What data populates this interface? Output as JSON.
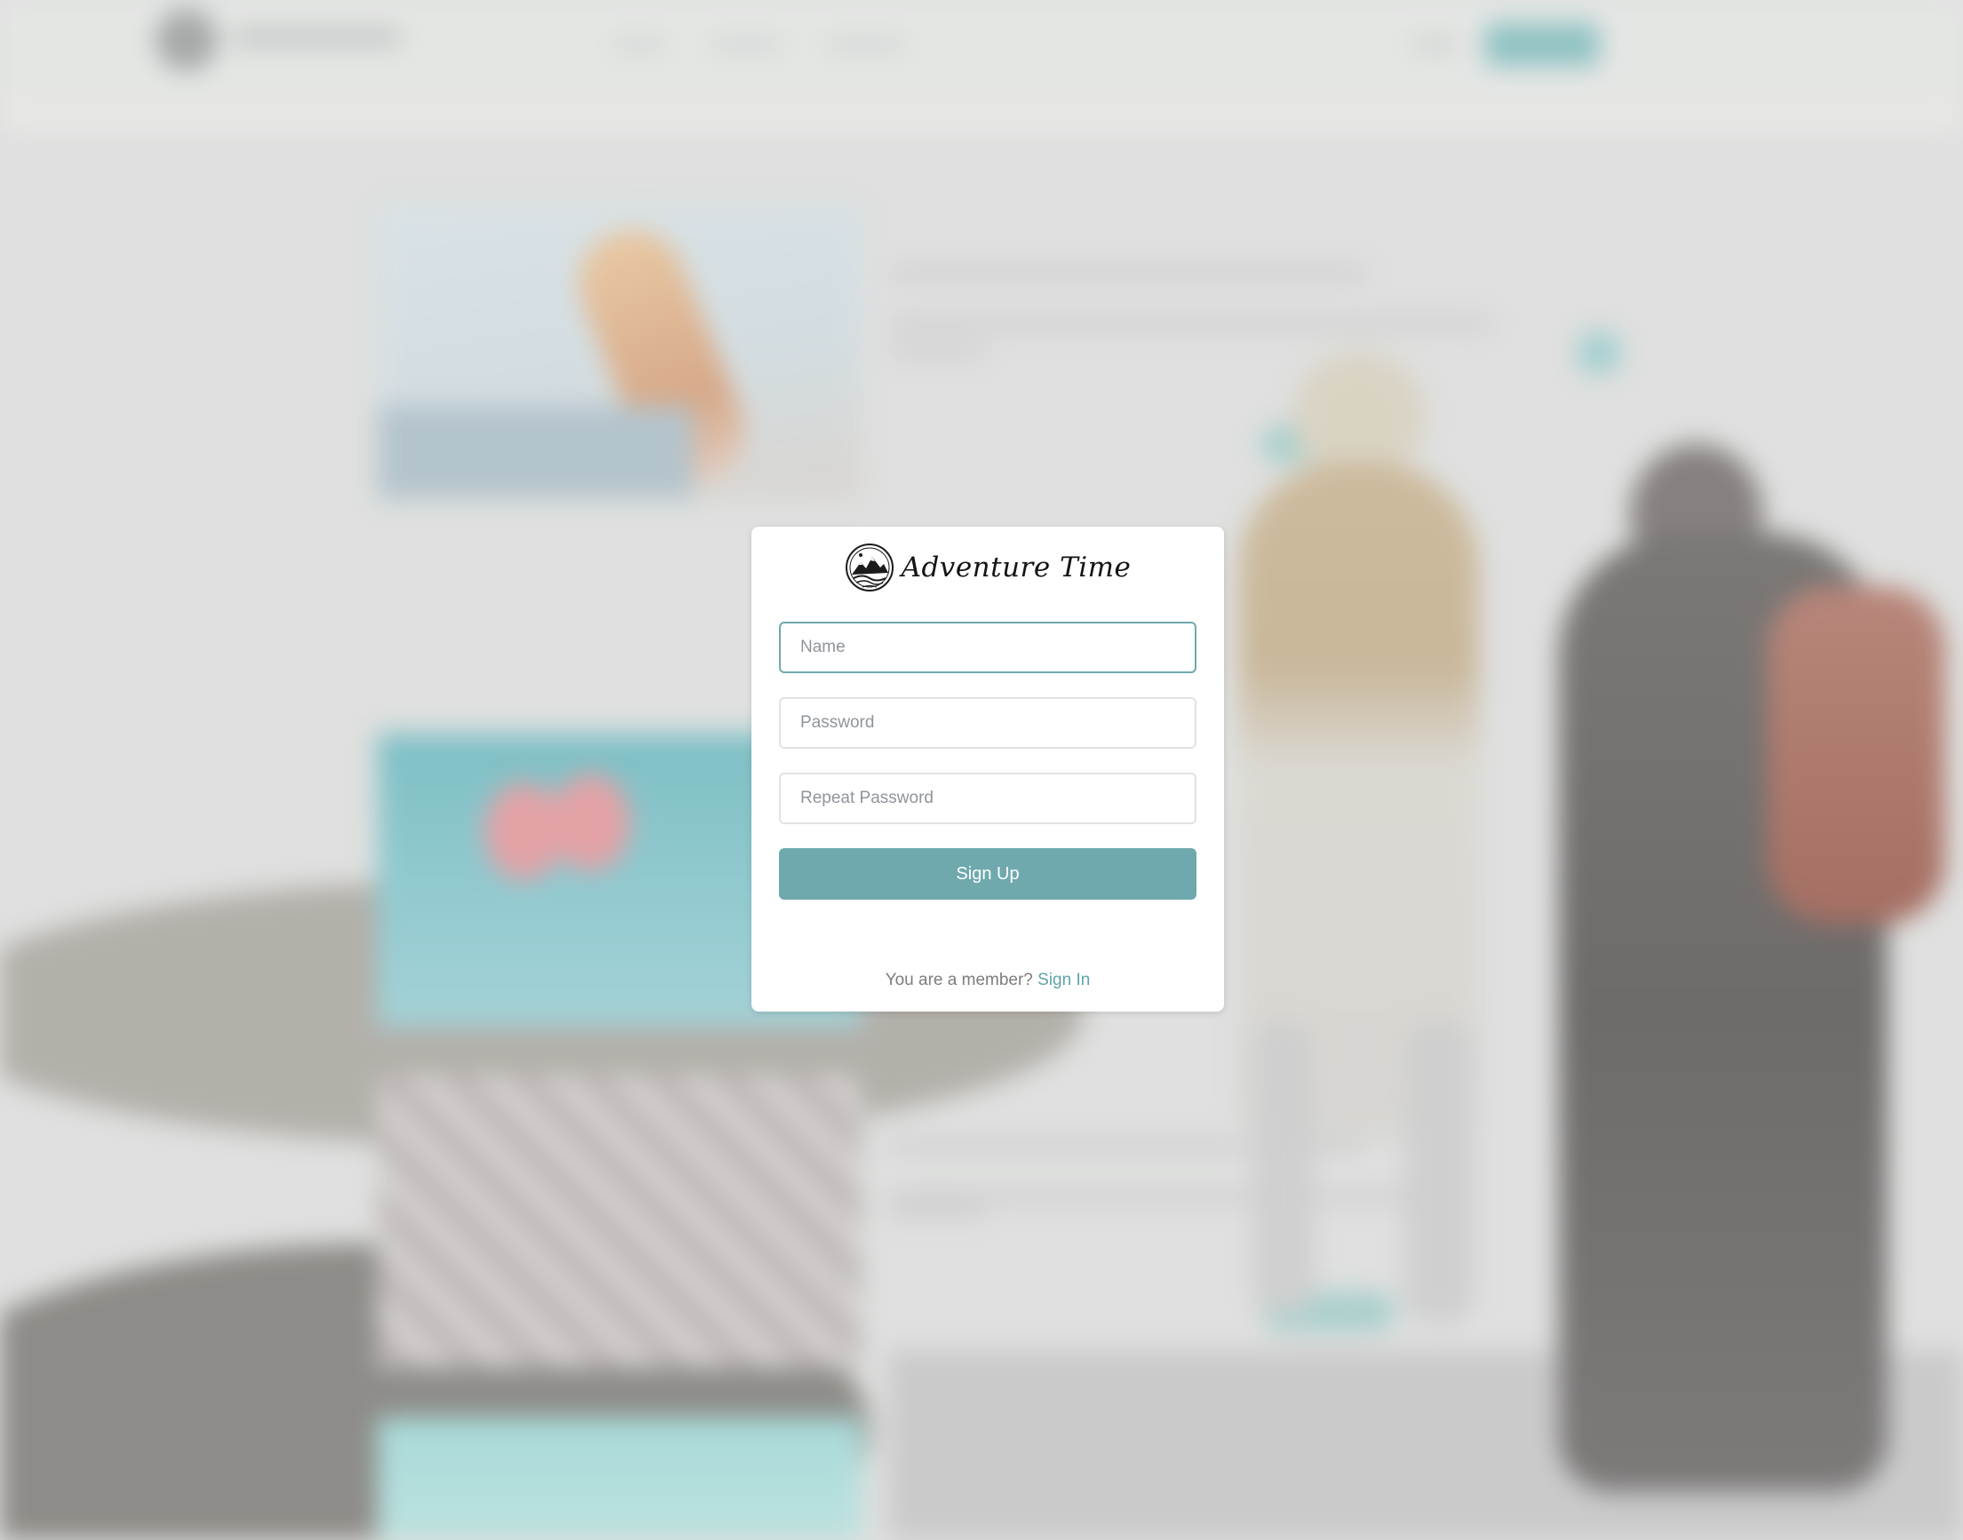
{
  "app": {
    "title": "Adventure Time"
  },
  "signup_form": {
    "name_placeholder": "Name",
    "password_placeholder": "Password",
    "repeat_password_placeholder": "Repeat Password",
    "submit_label": "Sign Up",
    "member_prompt": "You are a member?",
    "signin_label": "Sign In"
  },
  "colors": {
    "accent": "#6fa9ae",
    "link": "#5fa3a9",
    "modal_background": "#ffffff"
  },
  "icons": {
    "brand": "mountain-logo-icon"
  }
}
